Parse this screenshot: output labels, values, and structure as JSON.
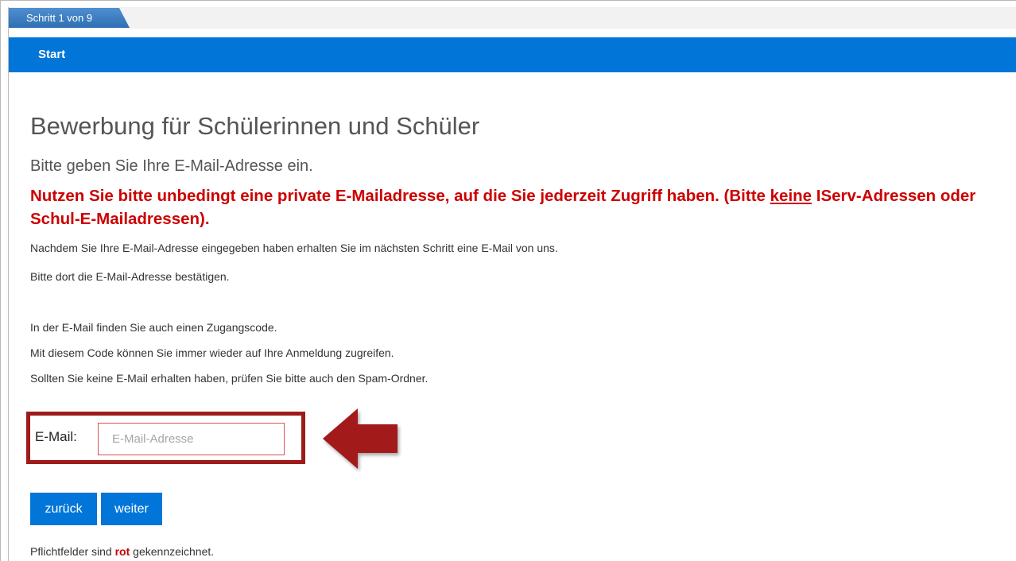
{
  "progress": {
    "step_label": "Schritt 1 von 9"
  },
  "section_bar": {
    "label": "Start"
  },
  "heading": {
    "title": "Bewerbung für Schülerinnen und Schüler",
    "subtitle": "Bitte geben Sie Ihre E-Mail-Adresse ein."
  },
  "warning": {
    "before": "Nutzen Sie bitte unbedingt eine private E-Mailadresse, auf die Sie jederzeit Zugriff haben. (Bitte ",
    "underlined": "keine",
    "after": " IServ-Adressen oder Schul-E-Mailadressen)."
  },
  "info_lines": [
    "Nachdem Sie Ihre E-Mail-Adresse eingegeben haben erhalten Sie im nächsten Schritt eine E-Mail von uns.",
    "Bitte dort die E-Mail-Adresse bestätigen.",
    "In der E-Mail finden Sie auch einen Zugangscode.",
    "Mit diesem Code können Sie immer wieder auf Ihre Anmeldung zugreifen.",
    "Sollten Sie keine E-Mail erhalten haben, prüfen Sie bitte auch den Spam-Ordner."
  ],
  "email_field": {
    "label": "E-Mail:",
    "value": "",
    "placeholder": "E-Mail-Adresse"
  },
  "buttons": {
    "back": "zurück",
    "next": "weiter"
  },
  "footnote": {
    "before": "Pflichtfelder sind ",
    "highlight": "rot",
    "after": " gekennzeichnet."
  },
  "colors": {
    "primary_blue": "#0276d8",
    "required_red": "#cc0000",
    "highlight_frame": "#9e1b1b"
  },
  "icons": {
    "callout_arrow": "arrow-left-icon"
  }
}
